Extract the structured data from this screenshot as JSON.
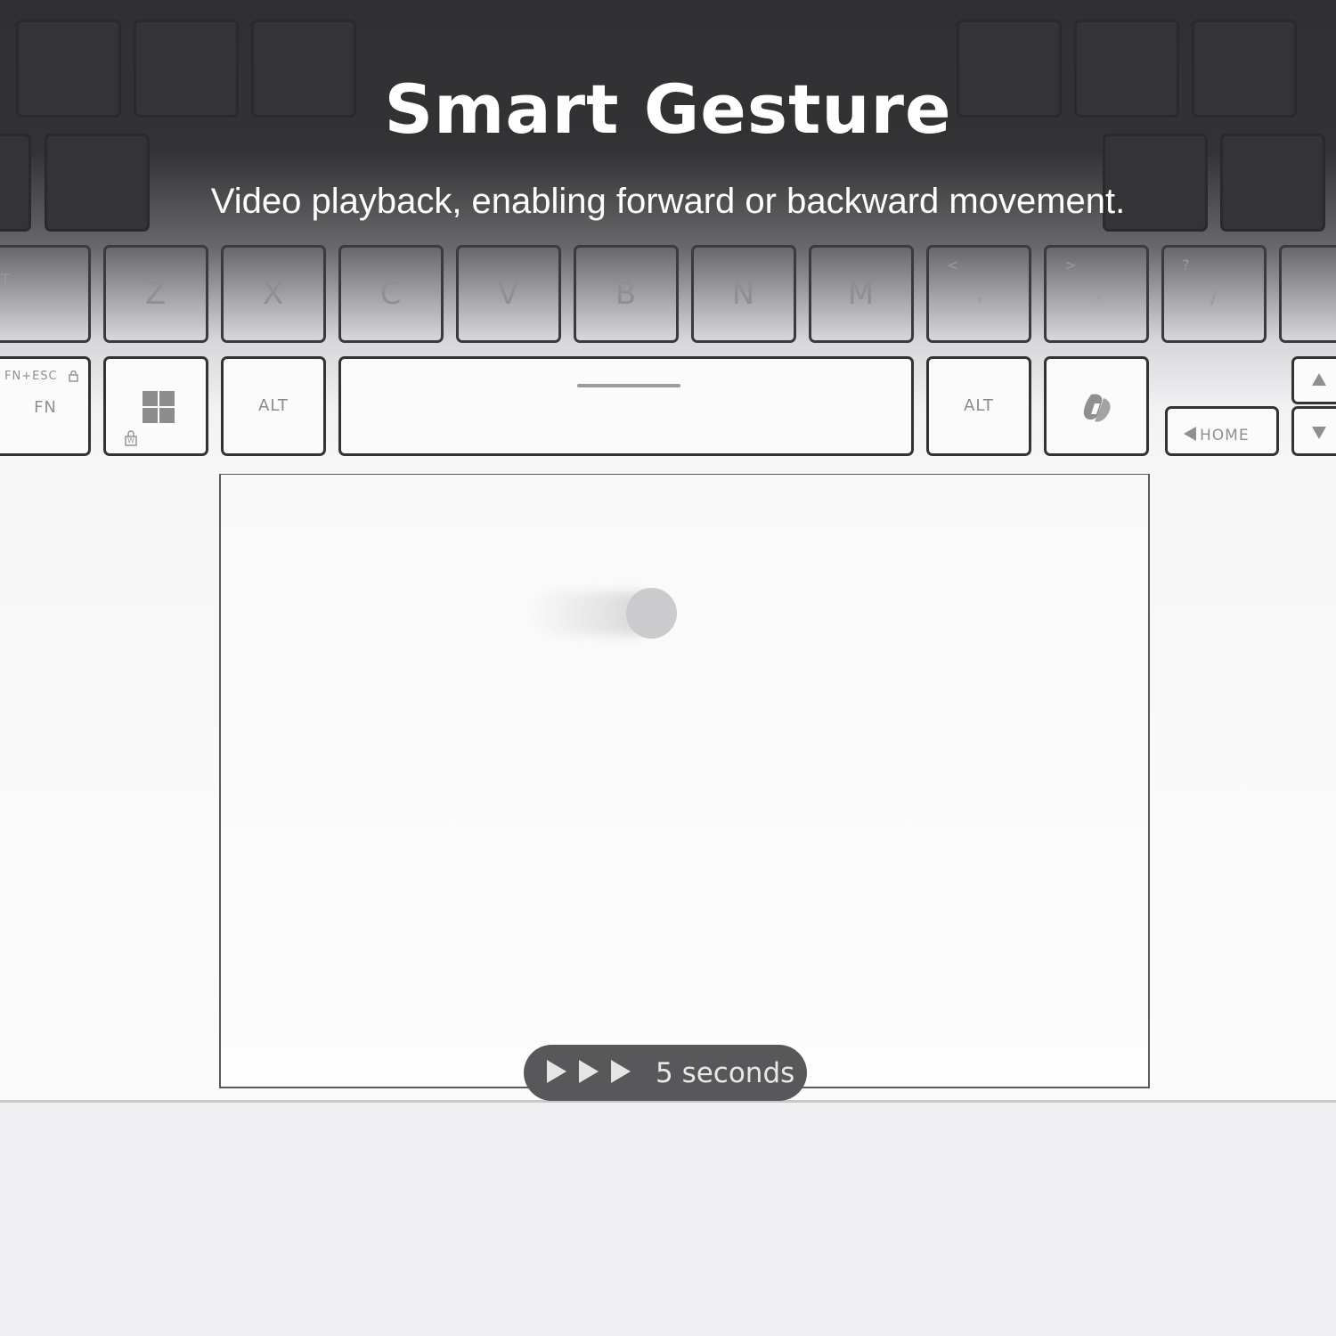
{
  "header": {
    "title": "Smart Gesture",
    "subtitle": "Video playback, enabling forward or backward movement."
  },
  "keyboard": {
    "bottom_letter_row": [
      "Z",
      "X",
      "C",
      "V",
      "B",
      "N",
      "M"
    ],
    "punctuation_keys": [
      {
        "top": "<",
        "bottom": ","
      },
      {
        "top": ">",
        "bottom": "."
      },
      {
        "top": "?",
        "bottom": "/"
      }
    ],
    "partial_left_key": "T",
    "fn_key": {
      "top": "FN+ESC",
      "label": "FN"
    },
    "alt_left": "ALT",
    "alt_right": "ALT",
    "home_key": "HOME",
    "windows_lock_label": "W"
  },
  "indicator": {
    "label": "5 seconds",
    "icon": "fast-forward-icon"
  },
  "colors": {
    "title_text": "#ffffff",
    "pill_bg": "#58585a",
    "keyboard_dark": "#303032"
  }
}
